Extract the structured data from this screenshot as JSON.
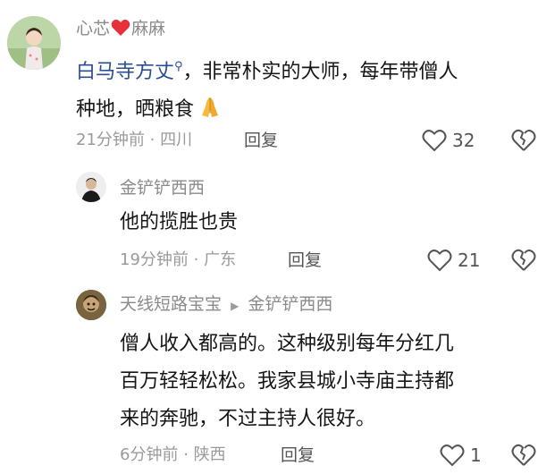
{
  "comments": [
    {
      "username_a": "心芯",
      "username_b": "麻麻",
      "username_heart": "red-heart-emoji",
      "mention": "白马寺方丈",
      "text_line1_rest": "，非常朴实的大师，每年带僧人",
      "text_line2": "种地，晒粮食",
      "emoji": "folded-hands-emoji",
      "time": "21分钟前",
      "location": "四川",
      "reply": "回复",
      "likes": "32"
    },
    {
      "username": "金铲铲西西",
      "text": "他的揽胜也贵",
      "time": "19分钟前",
      "location": "广东",
      "reply": "回复",
      "likes": "21"
    },
    {
      "username": "天线短路宝宝",
      "reply_to": "金铲铲西西",
      "text_lines": [
        "僧人收入都高的。这种级别每年分红几",
        "百万轻轻松松。我家县城小寺庙主持都",
        "来的奔驰，不过主持人很好。"
      ],
      "time": "6分钟前",
      "location": "陕西",
      "reply": "回复",
      "likes": "1"
    }
  ],
  "separator": "·"
}
